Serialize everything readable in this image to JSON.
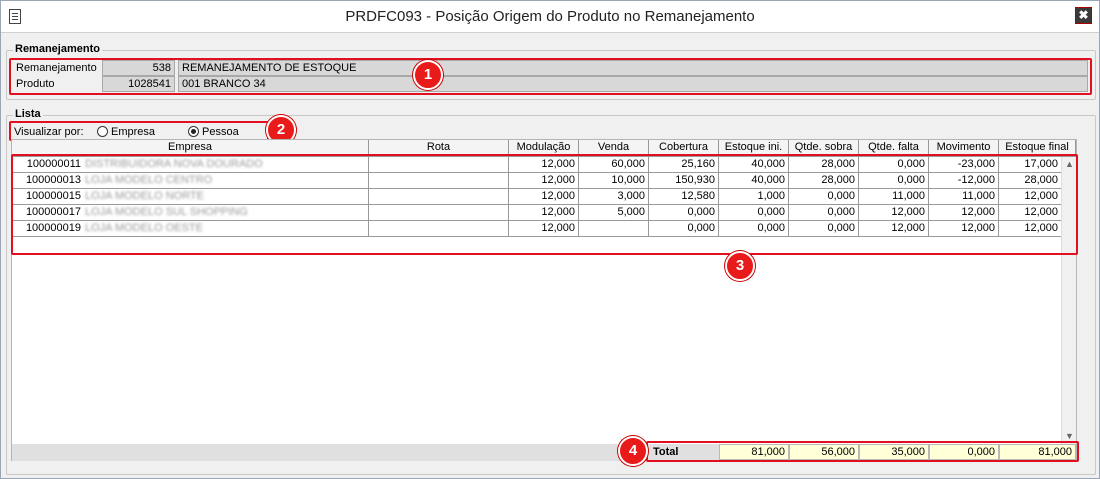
{
  "window": {
    "title": "PRDFC093 - Posição Origem do Produto no Remanejamento",
    "close_glyph": "✖"
  },
  "remanejamento": {
    "group_label": "Remanejamento",
    "rows": [
      {
        "label": "Remanejamento",
        "code": "538",
        "description": "REMANEJAMENTO DE ESTOQUE"
      },
      {
        "label": "Produto",
        "code": "1028541",
        "description": "001 BRANCO 34"
      }
    ]
  },
  "lista": {
    "group_label": "Lista",
    "visualizar_label": "Visualizar por:",
    "options": [
      {
        "label": "Empresa",
        "selected": false
      },
      {
        "label": "Pessoa",
        "selected": true
      }
    ]
  },
  "table": {
    "columns": [
      "Empresa",
      "Rota",
      "Modulação",
      "Venda",
      "Cobertura",
      "Estoque ini.",
      "Qtde. sobra",
      "Qtde. falta",
      "Movimento",
      "Estoque final"
    ],
    "rows": [
      {
        "code": "100000011",
        "name": "DISTRIBUIDORA NOVA DOURADO",
        "rota": "",
        "modulacao": "12,000",
        "venda": "60,000",
        "cobertura": "25,160",
        "estoque_ini": "40,000",
        "sobra": "28,000",
        "falta": "0,000",
        "movimento": "-23,000",
        "estoque_final": "17,000"
      },
      {
        "code": "100000013",
        "name": "LOJA MODELO CENTRO",
        "rota": "",
        "modulacao": "12,000",
        "venda": "10,000",
        "cobertura": "150,930",
        "estoque_ini": "40,000",
        "sobra": "28,000",
        "falta": "0,000",
        "movimento": "-12,000",
        "estoque_final": "28,000"
      },
      {
        "code": "100000015",
        "name": "LOJA MODELO NORTE",
        "rota": "",
        "modulacao": "12,000",
        "venda": "3,000",
        "cobertura": "12,580",
        "estoque_ini": "1,000",
        "sobra": "0,000",
        "falta": "11,000",
        "movimento": "11,000",
        "estoque_final": "12,000"
      },
      {
        "code": "100000017",
        "name": "LOJA MODELO SUL SHOPPING",
        "rota": "",
        "modulacao": "12,000",
        "venda": "5,000",
        "cobertura": "0,000",
        "estoque_ini": "0,000",
        "sobra": "0,000",
        "falta": "12,000",
        "movimento": "12,000",
        "estoque_final": "12,000"
      },
      {
        "code": "100000019",
        "name": "LOJA MODELO OESTE",
        "rota": "",
        "modulacao": "12,000",
        "venda": "",
        "cobertura": "0,000",
        "estoque_ini": "0,000",
        "sobra": "0,000",
        "falta": "12,000",
        "movimento": "12,000",
        "estoque_final": "12,000"
      }
    ],
    "total": {
      "label": "Total",
      "estoque_ini": "81,000",
      "sobra": "56,000",
      "falta": "35,000",
      "movimento": "0,000",
      "estoque_final": "81,000"
    }
  },
  "annotations": [
    "1",
    "2",
    "3",
    "4"
  ],
  "colors": {
    "annotation_red": "#e01020",
    "total_bg": "#ffffd8",
    "readonly_field": "#d8d8d8"
  }
}
